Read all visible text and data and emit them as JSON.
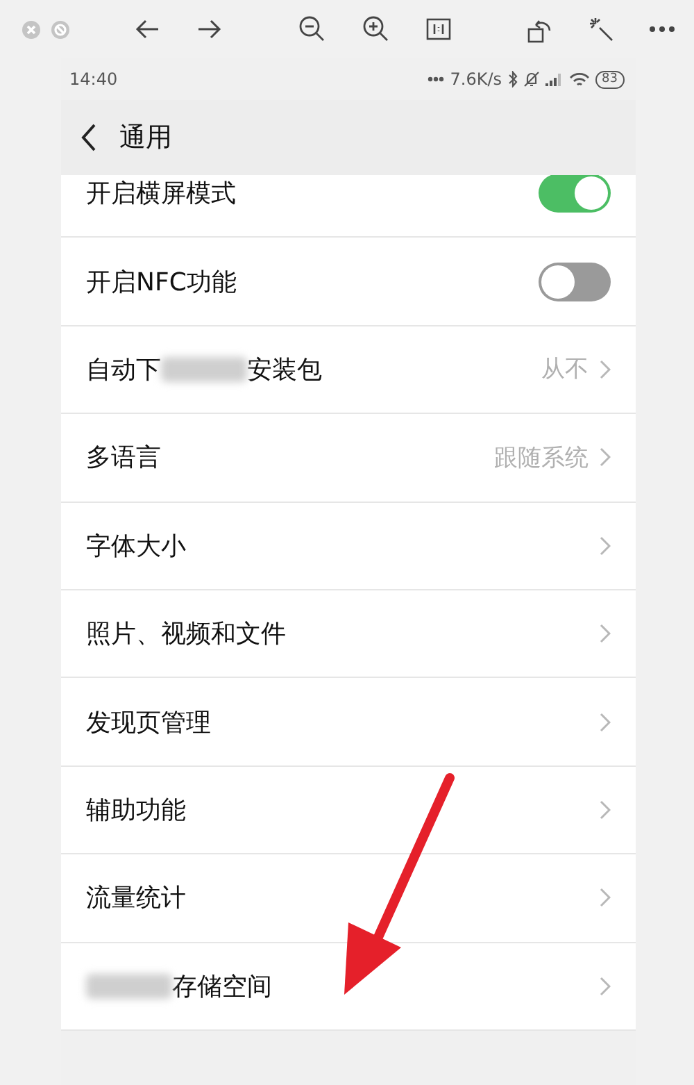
{
  "status_bar": {
    "time": "14:40",
    "speed": "7.6K/s",
    "battery": "83"
  },
  "header": {
    "title": "通用"
  },
  "rows": [
    {
      "kind": "toggle",
      "parts": [
        {
          "kind": "text",
          "text": "开启横屏模式"
        }
      ],
      "on": true
    },
    {
      "kind": "toggle",
      "parts": [
        {
          "kind": "text",
          "text": "开启NFC功能"
        }
      ],
      "on": false
    },
    {
      "kind": "link",
      "parts": [
        {
          "kind": "text",
          "text": "自动下"
        },
        {
          "kind": "blur"
        },
        {
          "kind": "text",
          "text": "安装包"
        }
      ],
      "value": "从不"
    },
    {
      "kind": "link",
      "parts": [
        {
          "kind": "text",
          "text": "多语言"
        }
      ],
      "value": "跟随系统"
    },
    {
      "kind": "link",
      "parts": [
        {
          "kind": "text",
          "text": "字体大小"
        }
      ]
    },
    {
      "kind": "link",
      "parts": [
        {
          "kind": "text",
          "text": "照片、视频和文件"
        }
      ]
    },
    {
      "kind": "link",
      "parts": [
        {
          "kind": "text",
          "text": "发现页管理"
        }
      ]
    },
    {
      "kind": "link",
      "parts": [
        {
          "kind": "text",
          "text": "辅助功能"
        }
      ]
    },
    {
      "kind": "link",
      "parts": [
        {
          "kind": "text",
          "text": "流量统计"
        }
      ]
    },
    {
      "kind": "link",
      "parts": [
        {
          "kind": "blur"
        },
        {
          "kind": "text",
          "text": "存储空间"
        }
      ]
    }
  ]
}
